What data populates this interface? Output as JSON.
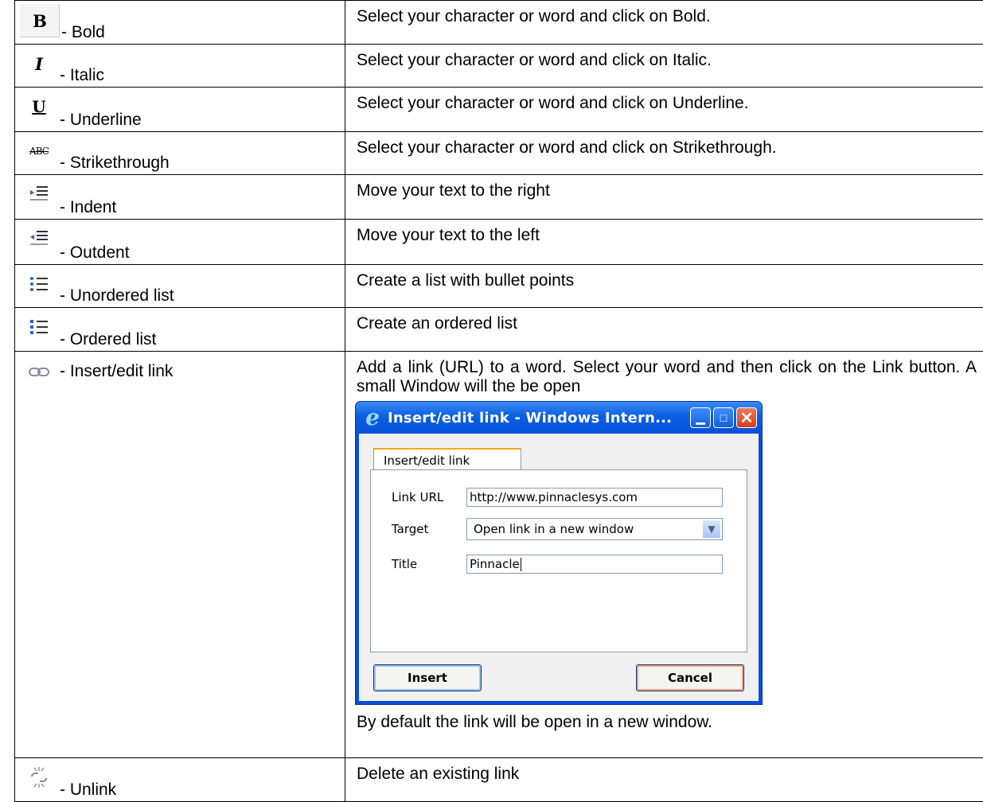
{
  "rows": [
    {
      "label": "- Bold",
      "icon": "bold-icon",
      "description": "Select your character or word and click on Bold."
    },
    {
      "label": "- Italic",
      "icon": "italic-icon",
      "description": "Select your character or word and click on Italic."
    },
    {
      "label": "- Underline",
      "icon": "underline-icon",
      "description": "Select your character or word and click on Underline."
    },
    {
      "label": "- Strikethrough",
      "icon": "strikethrough-icon",
      "description": "Select your character or word and click on Strikethrough."
    },
    {
      "label": "- Indent",
      "icon": "indent-icon",
      "description": "Move your text to the right"
    },
    {
      "label": "- Outdent",
      "icon": "outdent-icon",
      "description": "Move your text to the left"
    },
    {
      "label": "- Unordered list",
      "icon": "unordered-list-icon",
      "description": "Create a list with bullet points"
    },
    {
      "label": "- Ordered list",
      "icon": "ordered-list-icon",
      "description": "Create an ordered list"
    },
    {
      "label": "- Insert/edit link",
      "icon": "link-icon",
      "description": "Add a link (URL) to a word. Select your word and then click on the Link button. A small Window will the be open",
      "after": "By default the link will be open in a new window."
    },
    {
      "label": "- Unlink",
      "icon": "unlink-icon",
      "description": "Delete an existing link"
    }
  ],
  "dialog": {
    "title": "Insert/edit link - Windows Intern...",
    "tab": "Insert/edit link",
    "link_url_label": "Link URL",
    "link_url_value": "http://www.pinnaclesys.com",
    "target_label": "Target",
    "target_value": "Open link in a new window",
    "title_label": "Title",
    "title_value": "Pinnacle",
    "insert_label": "Insert",
    "cancel_label": "Cancel"
  }
}
